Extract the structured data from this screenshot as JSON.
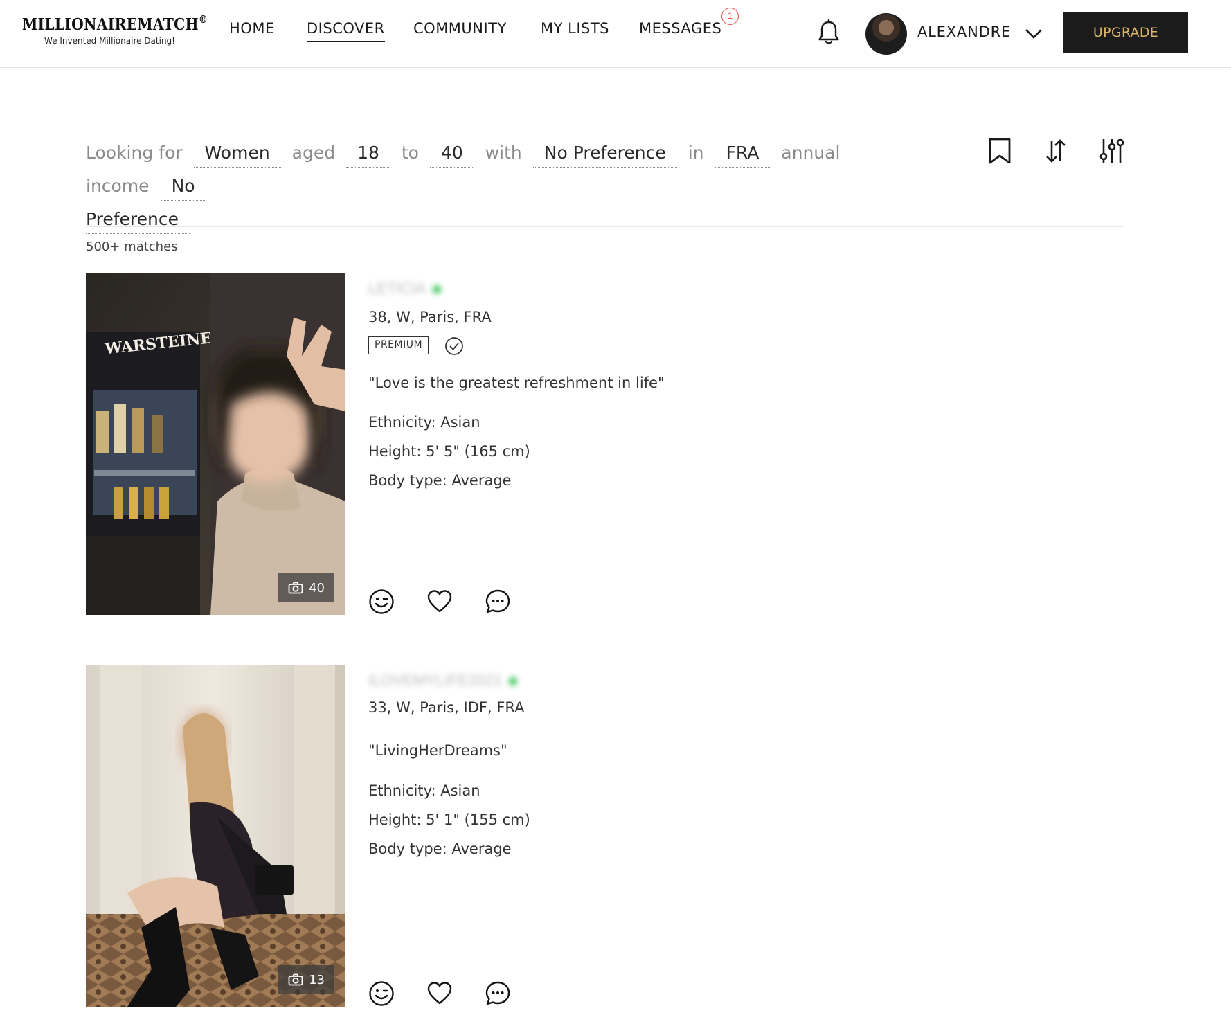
{
  "header": {
    "logo": {
      "wordmark": "MILLIONAIREMATCH",
      "registered": "®",
      "tagline": "We Invented Millionaire Dating!"
    },
    "nav": [
      {
        "label": "HOME",
        "active": false
      },
      {
        "label": "DISCOVER",
        "active": true
      },
      {
        "label": "COMMUNITY",
        "active": false
      },
      {
        "label": "MY LISTS",
        "active": false
      },
      {
        "label": "MESSAGES",
        "active": false
      }
    ],
    "messages_badge": "1",
    "notifications_icon": "bell-icon",
    "user": {
      "name": "ALEXANDRE",
      "menu_icon": "chevron-down-icon"
    },
    "upgrade_label": "UPGRADE"
  },
  "filter": {
    "looking_for": "Looking for",
    "gender": "Women",
    "aged": "aged",
    "age_min": "18",
    "to": "to",
    "age_max": "40",
    "with": "with",
    "preference": "No Preference",
    "in": "in",
    "country": "FRA",
    "annual_income": "annual income",
    "income_word1": "No",
    "income_word2": "Preference",
    "tools": [
      "bookmark-icon",
      "sort-icon",
      "filter-sliders-icon"
    ]
  },
  "results": {
    "match_count": "500+ matches",
    "profiles": [
      {
        "username": "LETICIA",
        "online": true,
        "location": "38, W, Paris, FRA",
        "premium": "PREMIUM",
        "verified": true,
        "photo_count": "40",
        "quote": "\"Love is the greatest refreshment in life\"",
        "ethnicity": "Ethnicity: Asian",
        "height": "Height: 5' 5\" (165 cm)",
        "body_type": "Body type: Average"
      },
      {
        "username": "ILOVEMYLIFE2021",
        "online": true,
        "location": "33, W, Paris, IDF, FRA",
        "photo_count": "13",
        "quote": "\"LivingHerDreams\"",
        "ethnicity": "Ethnicity: Asian",
        "height": "Height: 5' 1\" (155 cm)",
        "body_type": "Body type: Average"
      }
    ],
    "actions": [
      "wink-icon",
      "heart-icon",
      "chat-icon"
    ]
  },
  "colors": {
    "accent_gold": "#d9b36a",
    "button_dark": "#1b1b1b",
    "online_green": "#3cc45a",
    "badge_red": "#e05a4f"
  }
}
